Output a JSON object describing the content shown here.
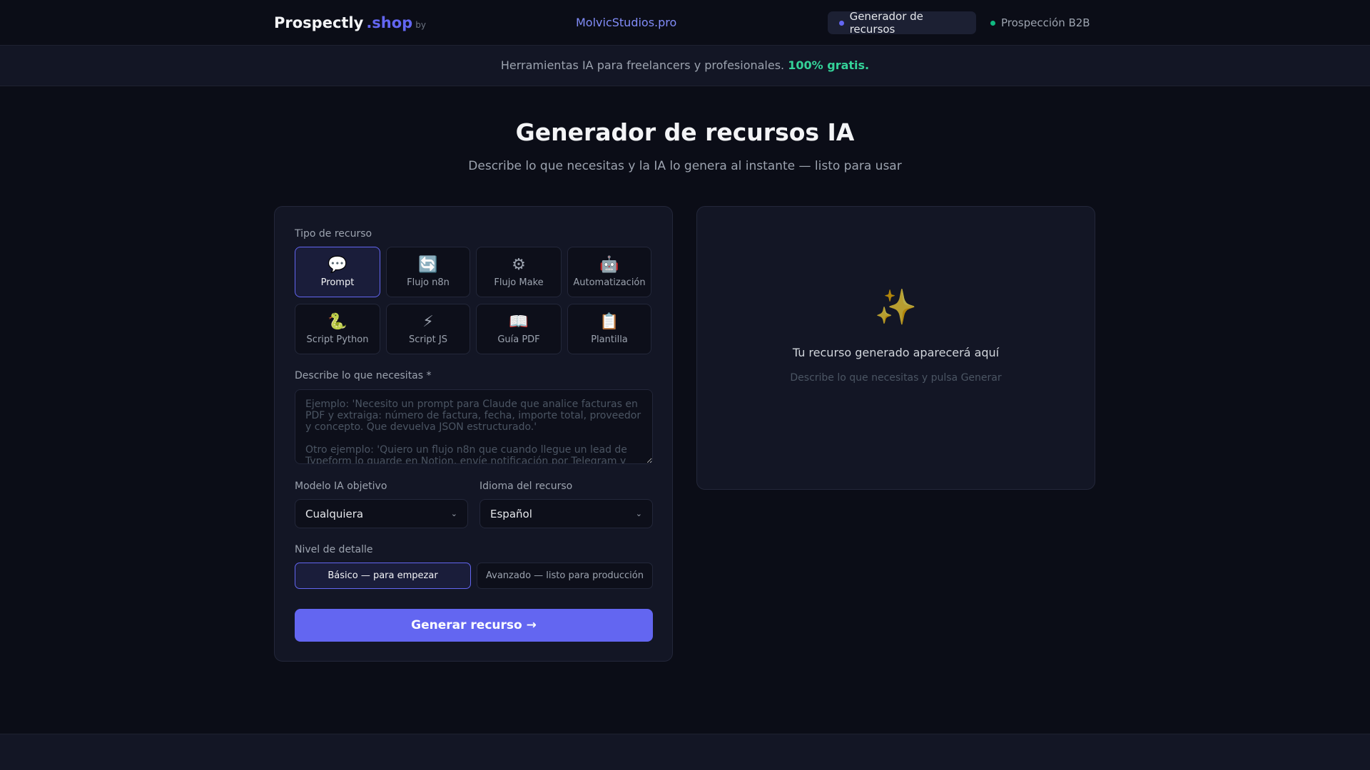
{
  "header": {
    "logo_main": "Prospectly",
    "logo_accent": ".shop",
    "logo_by": "by",
    "center_link": "MolvicStudios.pro",
    "nav": [
      {
        "label": "Generador de recursos",
        "dot": "#6366f1",
        "active": true
      },
      {
        "label": "Prospección B2B",
        "dot": "#10b981",
        "active": false
      }
    ]
  },
  "banner": {
    "text": "Herramientas IA para freelancers y profesionales.",
    "highlight": "100% gratis."
  },
  "page": {
    "title": "Generador de recursos IA",
    "subtitle": "Describe lo que necesitas y la IA lo genera al instante — listo para usar"
  },
  "form": {
    "type_label": "Tipo de recurso",
    "types": [
      {
        "icon": "💬",
        "label": "Prompt"
      },
      {
        "icon": "🔄",
        "label": "Flujo n8n"
      },
      {
        "icon": "⚙",
        "label": "Flujo Make"
      },
      {
        "icon": "🤖",
        "label": "Automatización"
      },
      {
        "icon": "🐍",
        "label": "Script Python"
      },
      {
        "icon": "⚡",
        "label": "Script JS"
      },
      {
        "icon": "📖",
        "label": "Guía PDF"
      },
      {
        "icon": "📋",
        "label": "Plantilla"
      }
    ],
    "describe_label": "Describe lo que necesitas *",
    "describe_placeholder": "Ejemplo: 'Necesito un prompt para Claude que analice facturas en PDF y extraiga: número de factura, fecha, importe total, proveedor y concepto. Que devuelva JSON estructurado.'\n\nOtro ejemplo: 'Quiero un flujo n8n que cuando llegue un lead de Typeform lo guarde en Notion, envíe notificación por Telegram y",
    "model_label": "Modelo IA objetivo",
    "model_value": "Cualquiera",
    "lang_label": "Idioma del recurso",
    "lang_value": "Español",
    "level_label": "Nivel de detalle",
    "level_basic": "Básico — para empezar",
    "level_advanced": "Avanzado — listo para producción",
    "generate": "Generar recurso →"
  },
  "output": {
    "icon": "✨",
    "title": "Tu recurso generado aparecerá aquí",
    "hint": "Describe lo que necesitas y pulsa Generar"
  }
}
